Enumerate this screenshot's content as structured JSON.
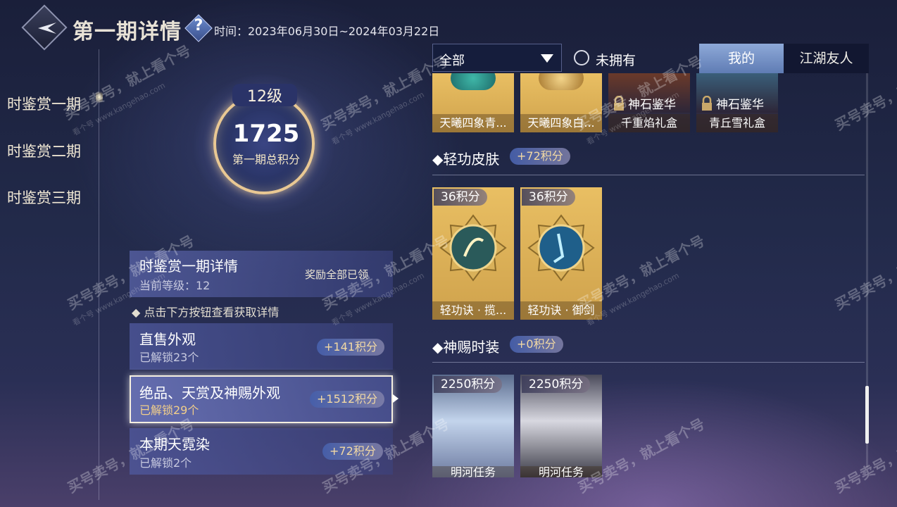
{
  "header": {
    "title": "第一期详情",
    "help_icon": "?",
    "time_range": "时间：2023年06月30日~2024年03月22日"
  },
  "nav": {
    "items": [
      {
        "label": "时鉴赏一期"
      },
      {
        "label": "时鉴赏二期"
      },
      {
        "label": "时鉴赏三期"
      }
    ]
  },
  "score": {
    "level": "12级",
    "total": "1725",
    "label": "第一期总积分"
  },
  "summary": {
    "title": "时鉴赏一期详情",
    "level_text": "当前等级：12",
    "status": "奖励全部已领"
  },
  "hint": "点击下方按钮查看获取详情",
  "categories": [
    {
      "title": "直售外观",
      "sub": "已解锁23个",
      "points": "+141积分"
    },
    {
      "title": "绝品、天赏及神赐外观",
      "sub": "已解锁29个",
      "points": "+1512积分"
    },
    {
      "title": "本期天霓染",
      "sub": "已解锁2个",
      "points": "+72积分"
    }
  ],
  "filter": {
    "selected": "全部",
    "radio_label": "未拥有",
    "tabs": [
      "我的",
      "江湖友人"
    ]
  },
  "top_row": [
    {
      "caption": "天曦四象青...",
      "overlay": ""
    },
    {
      "caption": "天曦四象白...",
      "overlay": ""
    },
    {
      "caption": "千重焰礼盒",
      "overlay": "神石鉴华"
    },
    {
      "caption": "青丘雪礼盒",
      "overlay": "神石鉴华"
    }
  ],
  "sections": [
    {
      "title": "轻功皮肤",
      "points": "+72积分",
      "items": [
        {
          "price": "36积分",
          "caption": "轻功诀 · 揽..."
        },
        {
          "price": "36积分",
          "caption": "轻功诀 · 御剑"
        }
      ]
    },
    {
      "title": "神赐时装",
      "points": "+0积分",
      "items": [
        {
          "price": "2250积分",
          "caption": "明河任务"
        },
        {
          "price": "2250积分",
          "caption": "明河任务"
        }
      ]
    }
  ],
  "watermark": {
    "main": "买号卖号，就上看个号",
    "site": "看个号 www.kangehao.com"
  },
  "colors": {
    "accent_gold": "#e9bf63",
    "tab_active": "#7e98cc",
    "points_text": "#f2d9a4"
  }
}
